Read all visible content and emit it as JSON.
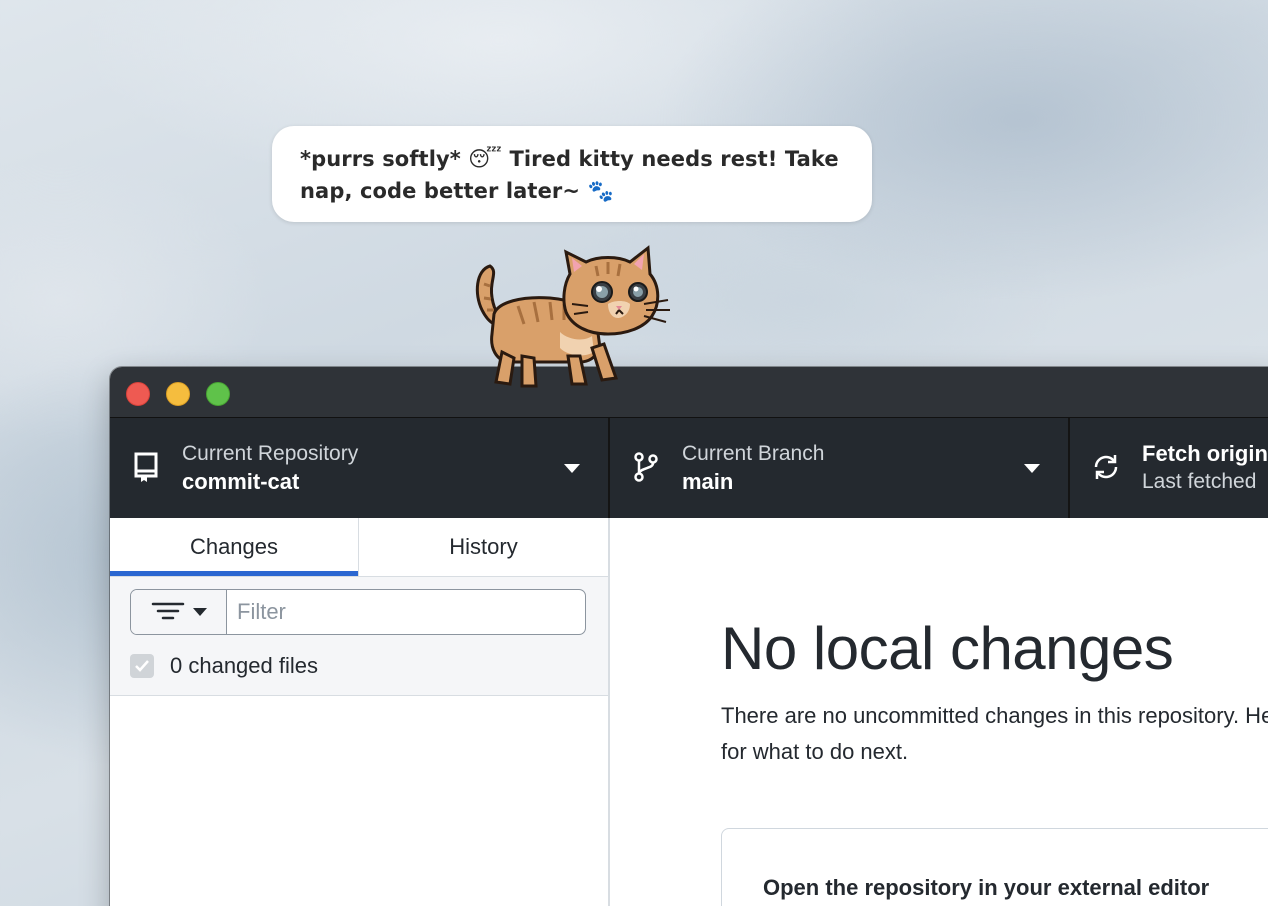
{
  "bubble": {
    "text": "*purrs softly* 😴 Tired kitty needs rest! Take nap, code better later~ 🐾"
  },
  "window": {
    "toolbar": {
      "repository": {
        "label": "Current Repository",
        "value": "commit-cat",
        "icon": "repo-icon"
      },
      "branch": {
        "label": "Current Branch",
        "value": "main",
        "icon": "branch-icon"
      },
      "fetch": {
        "label": "Fetch origin",
        "value": "Last fetched",
        "icon": "sync-icon"
      }
    },
    "tabs": [
      {
        "label": "Changes",
        "active": true
      },
      {
        "label": "History",
        "active": false
      }
    ],
    "filter": {
      "placeholder": "Filter",
      "icon": "filter-icon"
    },
    "changes": {
      "label": "0 changed files"
    },
    "main": {
      "title": "No local changes",
      "description_line1": "There are no uncommitted changes in this repository. Here are some friendly suggestions",
      "description_line2": "for what to do next.",
      "suggestion_title": "Open the repository in your external editor"
    }
  },
  "colors": {
    "toolbar_bg": "#24292f",
    "active_tab_accent": "#2b67d1",
    "close": "#ee5a52",
    "minimize": "#f5bd3e",
    "maximize": "#5fc24a"
  }
}
